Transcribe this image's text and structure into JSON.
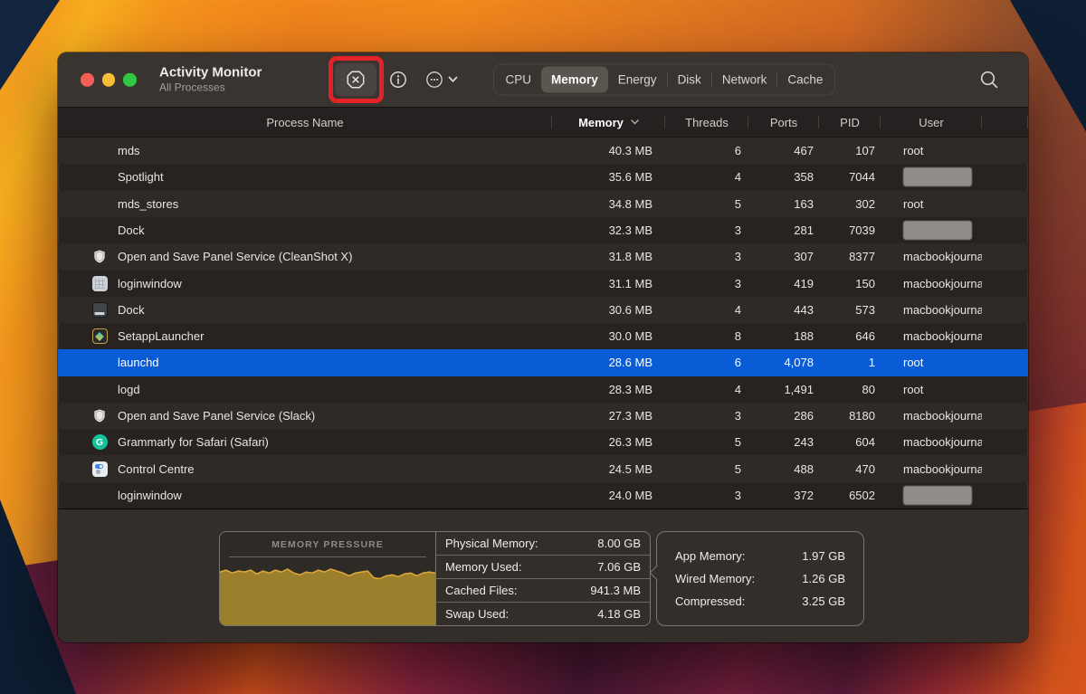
{
  "window": {
    "title": "Activity Monitor",
    "subtitle": "All Processes"
  },
  "colors": {
    "selection_blue": "#0a5cd6",
    "highlight_red": "#e32229",
    "traffic_lights": [
      "#f35f57",
      "#f6bd35",
      "#2fc840"
    ],
    "pressure_fill": "#9c7f2c",
    "pressure_line": "#d9a63c"
  },
  "toolbar": {
    "tabs": [
      "CPU",
      "Memory",
      "Energy",
      "Disk",
      "Network",
      "Cache"
    ],
    "selected_tab_index": 1
  },
  "table": {
    "columns": [
      {
        "label": "Process Name"
      },
      {
        "label": "Memory",
        "sorted": true
      },
      {
        "label": "Threads"
      },
      {
        "label": "Ports"
      },
      {
        "label": "PID"
      },
      {
        "label": "User"
      }
    ],
    "rows": [
      {
        "name": "mds",
        "icon": null,
        "memory": "40.3 MB",
        "threads": "6",
        "ports": "467",
        "pid": "107",
        "user": "root",
        "user_redacted": false,
        "selected": false
      },
      {
        "name": "Spotlight",
        "icon": null,
        "memory": "35.6 MB",
        "threads": "4",
        "ports": "358",
        "pid": "7044",
        "user": "",
        "user_redacted": true,
        "selected": false
      },
      {
        "name": "mds_stores",
        "icon": null,
        "memory": "34.8 MB",
        "threads": "5",
        "ports": "163",
        "pid": "302",
        "user": "root",
        "user_redacted": false,
        "selected": false
      },
      {
        "name": "Dock",
        "icon": null,
        "memory": "32.3 MB",
        "threads": "3",
        "ports": "281",
        "pid": "7039",
        "user": "",
        "user_redacted": true,
        "selected": false
      },
      {
        "name": "Open and Save Panel Service (CleanShot X)",
        "icon": "shield",
        "memory": "31.8 MB",
        "threads": "3",
        "ports": "307",
        "pid": "8377",
        "user": "macbookjourna",
        "user_redacted": false,
        "selected": false
      },
      {
        "name": "loginwindow",
        "icon": "loginwindow",
        "memory": "31.1 MB",
        "threads": "3",
        "ports": "419",
        "pid": "150",
        "user": "macbookjourna",
        "user_redacted": false,
        "selected": false
      },
      {
        "name": "Dock",
        "icon": "dock",
        "memory": "30.6 MB",
        "threads": "4",
        "ports": "443",
        "pid": "573",
        "user": "macbookjourna",
        "user_redacted": false,
        "selected": false
      },
      {
        "name": "SetappLauncher",
        "icon": "setapp",
        "memory": "30.0 MB",
        "threads": "8",
        "ports": "188",
        "pid": "646",
        "user": "macbookjourna",
        "user_redacted": false,
        "selected": false
      },
      {
        "name": "launchd",
        "icon": null,
        "memory": "28.6 MB",
        "threads": "6",
        "ports": "4,078",
        "pid": "1",
        "user": "root",
        "user_redacted": false,
        "selected": true
      },
      {
        "name": "logd",
        "icon": null,
        "memory": "28.3 MB",
        "threads": "4",
        "ports": "1,491",
        "pid": "80",
        "user": "root",
        "user_redacted": false,
        "selected": false
      },
      {
        "name": "Open and Save Panel Service (Slack)",
        "icon": "shield",
        "memory": "27.3 MB",
        "threads": "3",
        "ports": "286",
        "pid": "8180",
        "user": "macbookjourna",
        "user_redacted": false,
        "selected": false
      },
      {
        "name": "Grammarly for Safari (Safari)",
        "icon": "grammarly",
        "memory": "26.3 MB",
        "threads": "5",
        "ports": "243",
        "pid": "604",
        "user": "macbookjourna",
        "user_redacted": false,
        "selected": false
      },
      {
        "name": "Control Centre",
        "icon": "control-centre",
        "memory": "24.5 MB",
        "threads": "5",
        "ports": "488",
        "pid": "470",
        "user": "macbookjourna",
        "user_redacted": false,
        "selected": false
      },
      {
        "name": "loginwindow",
        "icon": null,
        "memory": "24.0 MB",
        "threads": "3",
        "ports": "372",
        "pid": "6502",
        "user": "",
        "user_redacted": true,
        "selected": false
      }
    ]
  },
  "footer": {
    "memory_pressure": {
      "title": "MEMORY PRESSURE",
      "type": "area",
      "values": [
        0.44,
        0.42,
        0.45,
        0.43,
        0.44,
        0.42,
        0.46,
        0.43,
        0.45,
        0.42,
        0.44,
        0.41,
        0.45,
        0.47,
        0.44,
        0.45,
        0.42,
        0.44,
        0.41,
        0.43,
        0.45,
        0.48,
        0.45,
        0.44,
        0.43,
        0.5,
        0.51,
        0.48,
        0.47,
        0.49,
        0.46,
        0.45,
        0.48,
        0.45,
        0.44,
        0.45
      ]
    },
    "left_stats": [
      {
        "label": "Physical Memory:",
        "value": "8.00 GB"
      },
      {
        "label": "Memory Used:",
        "value": "7.06 GB"
      },
      {
        "label": "Cached Files:",
        "value": "941.3 MB"
      },
      {
        "label": "Swap Used:",
        "value": "4.18 GB"
      }
    ],
    "right_stats": [
      {
        "label": "App Memory:",
        "value": "1.97 GB"
      },
      {
        "label": "Wired Memory:",
        "value": "1.26 GB"
      },
      {
        "label": "Compressed:",
        "value": "3.25 GB"
      }
    ]
  }
}
